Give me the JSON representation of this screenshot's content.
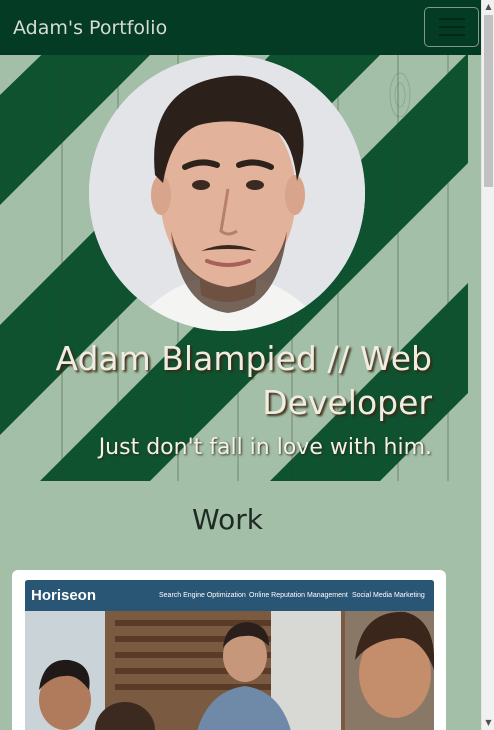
{
  "navbar": {
    "brand": "Adam's Portfolio",
    "toggle_icon": "hamburger-menu-icon"
  },
  "hero": {
    "title": "Adam Blampied // Web Developer",
    "subtitle": "Just don't fall in love with him.",
    "avatar_icon": "profile-photo"
  },
  "work": {
    "heading": "Work",
    "projects": [
      {
        "site_logo": "Horiseon",
        "site_nav": [
          "Search Engine Optimization",
          "Online Reputation Management",
          "Social Media Marketing"
        ]
      }
    ]
  },
  "colors": {
    "navbar_bg": "#043b24",
    "page_bg": "#a4bfa7",
    "stripe": "#0e5230"
  }
}
